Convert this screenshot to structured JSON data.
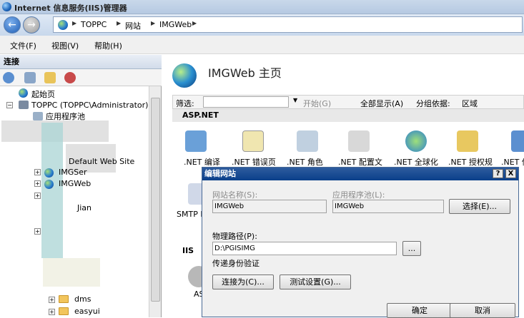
{
  "window": {
    "title": "Internet 信息服务(IIS)管理器"
  },
  "address": {
    "crumbs": [
      "TOPPC",
      "网站",
      "IMGWeb"
    ]
  },
  "menu": {
    "items": [
      "文件(F)",
      "视图(V)",
      "帮助(H)"
    ]
  },
  "connections": {
    "header": "连接",
    "tree": [
      "起始页",
      "TOPPC (TOPPC\\Administrator)",
      "应用程序池",
      "Default Web Site",
      "IMGSer",
      "IMGWeb",
      "Jian",
      "dms",
      "easyui"
    ]
  },
  "main": {
    "title": "IMGWeb 主页",
    "filter_label": "筛选:",
    "start_label": "开始(G)",
    "show_all_label": "全部显示(A)",
    "group_label": "分组依据:",
    "group_value": "区域",
    "section_aspnet": "ASP.NET",
    "section_iis": "IIS",
    "features": [
      ".NET 编译",
      ".NET 错误页",
      ".NET 角色",
      ".NET 配置文",
      ".NET 全球化",
      ".NET 授权规",
      ".NET 信"
    ],
    "row2_labels": [
      "SMTP E",
      "AS"
    ]
  },
  "dialog": {
    "title": "编辑网站",
    "help_btn": "?",
    "close_btn": "X",
    "site_name_label": "网站名称(S):",
    "site_name_value": "IMGWeb",
    "app_pool_label": "应用程序池(L):",
    "app_pool_value": "IMGWeb",
    "select_btn": "选择(E)...",
    "phys_path_label": "物理路径(P):",
    "phys_path_value": "D:\\PGISIMG",
    "browse_btn": "...",
    "passthrough_label": "传递身份验证",
    "connect_as_btn": "连接为(C)...",
    "test_btn": "测试设置(G)...",
    "ok_btn": "确定",
    "cancel_btn": "取消"
  }
}
